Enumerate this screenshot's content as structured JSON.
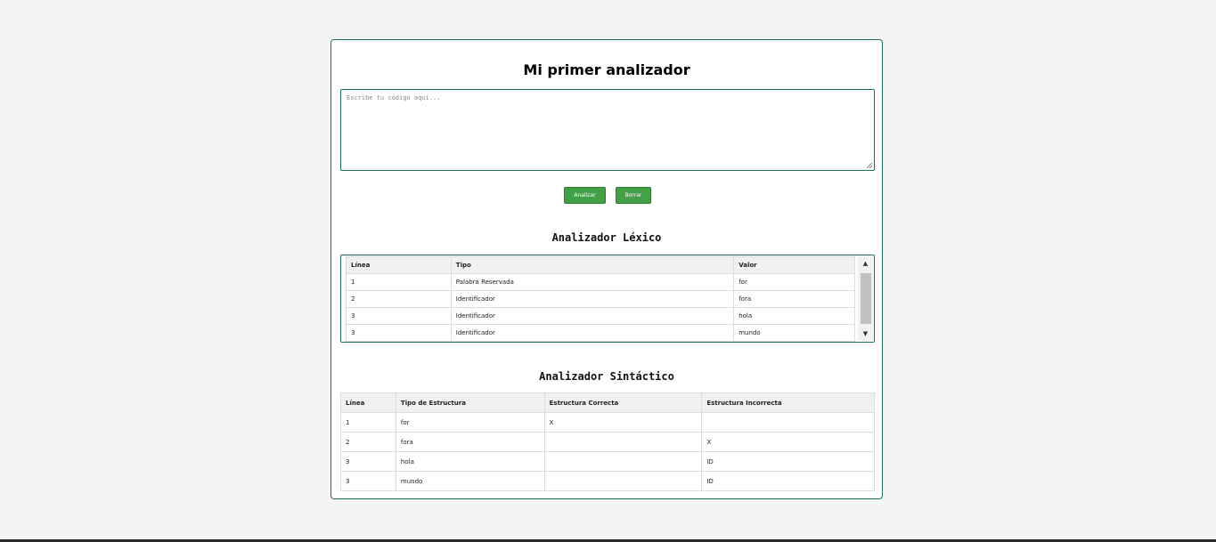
{
  "app": {
    "title": "Mi primer analizador"
  },
  "editor": {
    "placeholder": "Escribe tu código aquí...",
    "value": ""
  },
  "actions": {
    "analyze_label": "Analizar",
    "clear_label": "Borrar"
  },
  "lexical": {
    "title": "Analizador Léxico",
    "headers": [
      "Línea",
      "Tipo",
      "Valor"
    ],
    "rows": [
      [
        "1",
        "Palabra Reservada",
        "for"
      ],
      [
        "2",
        "Identificador",
        "fora"
      ],
      [
        "3",
        "Identificador",
        "hola"
      ],
      [
        "3",
        "Identificador",
        "mundo"
      ]
    ]
  },
  "syntactic": {
    "title": "Analizador Sintáctico",
    "headers": [
      "Línea",
      "Tipo de Estructura",
      "Estructura Correcta",
      "Estructura Incorrecta"
    ],
    "rows": [
      [
        "1",
        "for",
        "X",
        ""
      ],
      [
        "2",
        "fora",
        "",
        "X"
      ],
      [
        "3",
        "hola",
        "",
        "ID"
      ],
      [
        "3",
        "mundo",
        "",
        "ID"
      ]
    ]
  },
  "colors": {
    "accent_border": "#1f6f5b",
    "button_bg": "#43a047",
    "page_bg": "#f4f4f4"
  },
  "icons": {
    "scroll_up": "scroll-up-arrow-icon",
    "scroll_down": "scroll-down-arrow-icon",
    "resize": "resize-grip-icon"
  }
}
